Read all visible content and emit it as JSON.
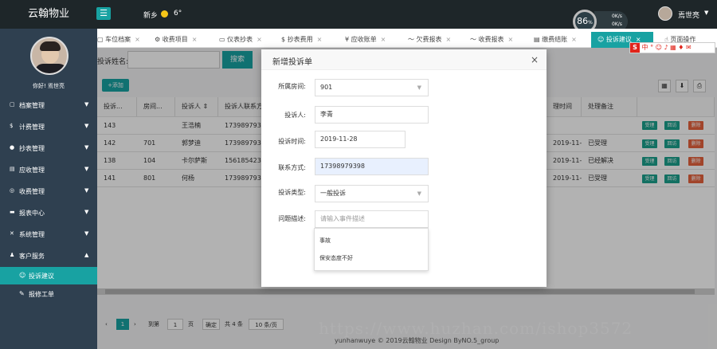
{
  "topbar": {
    "brand": "云翰物业",
    "menu_icon": "hamburger-icon",
    "location": "新乡",
    "temperature": "6°",
    "gauge_value": "86",
    "gauge_unit": "%",
    "net_up": "0K/s",
    "net_down": "0K/s",
    "username": "焉世亮",
    "caret": "▼"
  },
  "sidebar": {
    "greeting": "你好! 焉世亮",
    "items": [
      {
        "icon": "file-icon",
        "label": "档案管理"
      },
      {
        "icon": "money-icon",
        "label": "计费管理"
      },
      {
        "icon": "circle-icon",
        "label": "抄表管理"
      },
      {
        "icon": "ledger-icon",
        "label": "应收管理"
      },
      {
        "icon": "coin-icon",
        "label": "收费管理"
      },
      {
        "icon": "report-icon",
        "label": "报表中心"
      },
      {
        "icon": "wrench-icon",
        "label": "系统管理"
      },
      {
        "icon": "user-icon",
        "label": "客户服务"
      }
    ],
    "sub_items": [
      {
        "icon": "smile-icon",
        "label": "投诉建议",
        "active": true
      },
      {
        "icon": "edit-icon",
        "label": "报修工单",
        "active": false
      }
    ]
  },
  "tabs": [
    {
      "label": "车位档案"
    },
    {
      "label": "收费项目"
    },
    {
      "label": "仪表抄表"
    },
    {
      "label": "抄表费用"
    },
    {
      "label": "应收账单"
    },
    {
      "label": "欠费报表"
    },
    {
      "label": "收费报表"
    },
    {
      "label": "缴费结账"
    },
    {
      "label": "投诉建议",
      "active": true
    },
    {
      "label": "页面操作"
    }
  ],
  "search": {
    "label": "投诉姓名:",
    "button": "搜索"
  },
  "toolbar": {
    "add": "+添加"
  },
  "table": {
    "headers": [
      "投诉...",
      "房间...",
      "投诉人",
      "投诉人联系方式",
      "理时间",
      "处理备注"
    ],
    "sort_icon": "⇕",
    "rows": [
      {
        "id": "143",
        "room": "",
        "name": "王浩楠",
        "phone": "1739897939",
        "time": "",
        "remark": ""
      },
      {
        "id": "142",
        "room": "701",
        "name": "郭梦迪",
        "phone": "1739897939",
        "time": "2019-11-...",
        "remark": "已受理"
      },
      {
        "id": "138",
        "room": "104",
        "name": "卡尔萨斯",
        "phone": "1561854232",
        "time": "2019-11-...",
        "remark": "已经解决"
      },
      {
        "id": "141",
        "room": "801",
        "name": "何杨",
        "phone": "1739897939",
        "time": "2019-11-...",
        "remark": "已受理"
      }
    ],
    "actions": [
      "受理",
      "回访",
      "删除"
    ]
  },
  "pager": {
    "current": "1",
    "goto_label": "到第",
    "goto_value": "1",
    "page_unit": "页",
    "confirm": "确定",
    "total": "共 4 条",
    "per_page": "10 条/页"
  },
  "footer": "yunhanwuye © 2019云翰物业 Design ByNO.5_group",
  "modal": {
    "title": "新增投诉单",
    "close": "×",
    "fields": {
      "room_label": "所属房间:",
      "room_value": "901",
      "person_label": "投诉人:",
      "person_value": "李青",
      "time_label": "投诉时间:",
      "time_value": "2019-11-28",
      "contact_label": "联系方式:",
      "contact_value": "17398979398",
      "type_label": "投诉类型:",
      "type_value": "一般投诉",
      "desc_label": "问题描述:",
      "desc_placeholder": "请输入事件描述"
    },
    "dropdown_options": [
      "事故",
      "保安态度不好"
    ]
  },
  "ime": {
    "label": "中"
  },
  "watermark": "https://www.huzhan.com/ishop3572"
}
